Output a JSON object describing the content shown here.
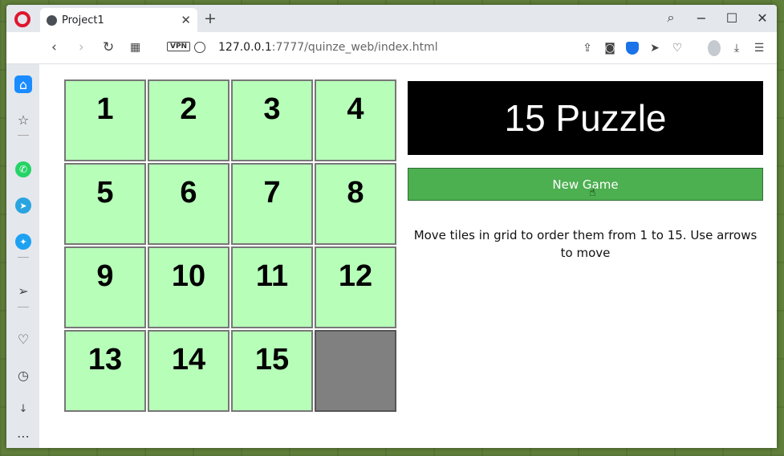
{
  "browser": {
    "tab_title": "Project1",
    "tab_close": "✕",
    "new_tab": "+",
    "url_host": "127.0.0.1",
    "url_rest": ":7777/quinze_web/index.html",
    "vpn_label": "VPN",
    "window_controls": [
      "minimize-icon",
      "maximize-icon",
      "close-icon"
    ]
  },
  "sidebar": {
    "items": [
      "home-icon",
      "star-icon",
      "whatsapp-icon",
      "telegram-icon",
      "twitter-icon",
      "send-icon",
      "heart-icon",
      "history-icon",
      "download-icon",
      "more-icon"
    ]
  },
  "game": {
    "title": "15 Puzzle",
    "new_game_label": "New Game",
    "instructions": "Move tiles in grid to order them from 1 to 15. Use arrows to move",
    "tiles": [
      "1",
      "2",
      "3",
      "4",
      "5",
      "6",
      "7",
      "8",
      "9",
      "10",
      "11",
      "12",
      "13",
      "14",
      "15",
      ""
    ],
    "colors": {
      "tile": "#b7ffb9",
      "empty_tile": "#808080",
      "button": "#4caf50",
      "title_bg": "#000000"
    }
  }
}
